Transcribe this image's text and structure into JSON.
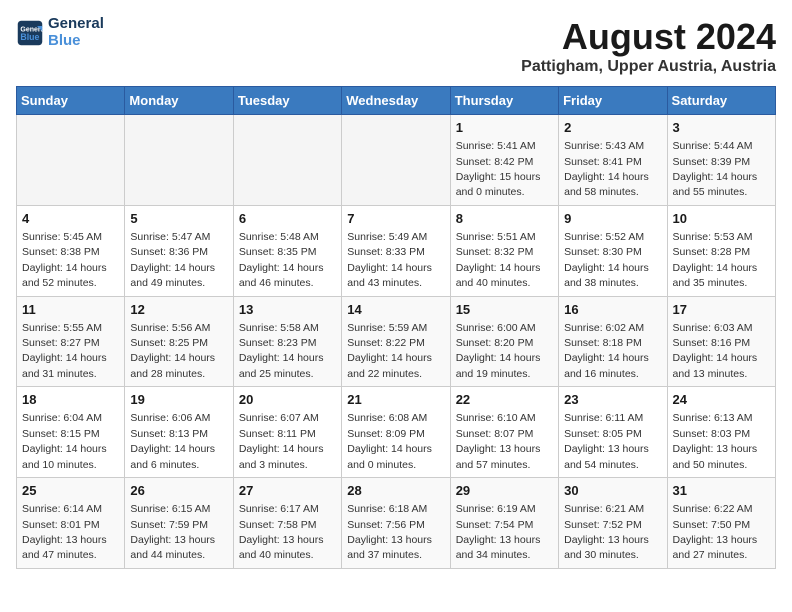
{
  "logo": {
    "line1": "General",
    "line2": "Blue"
  },
  "title": "August 2024",
  "subtitle": "Pattigham, Upper Austria, Austria",
  "days_of_week": [
    "Sunday",
    "Monday",
    "Tuesday",
    "Wednesday",
    "Thursday",
    "Friday",
    "Saturday"
  ],
  "weeks": [
    [
      {
        "day": "",
        "info": ""
      },
      {
        "day": "",
        "info": ""
      },
      {
        "day": "",
        "info": ""
      },
      {
        "day": "",
        "info": ""
      },
      {
        "day": "1",
        "info": "Sunrise: 5:41 AM\nSunset: 8:42 PM\nDaylight: 15 hours and 0 minutes."
      },
      {
        "day": "2",
        "info": "Sunrise: 5:43 AM\nSunset: 8:41 PM\nDaylight: 14 hours and 58 minutes."
      },
      {
        "day": "3",
        "info": "Sunrise: 5:44 AM\nSunset: 8:39 PM\nDaylight: 14 hours and 55 minutes."
      }
    ],
    [
      {
        "day": "4",
        "info": "Sunrise: 5:45 AM\nSunset: 8:38 PM\nDaylight: 14 hours and 52 minutes."
      },
      {
        "day": "5",
        "info": "Sunrise: 5:47 AM\nSunset: 8:36 PM\nDaylight: 14 hours and 49 minutes."
      },
      {
        "day": "6",
        "info": "Sunrise: 5:48 AM\nSunset: 8:35 PM\nDaylight: 14 hours and 46 minutes."
      },
      {
        "day": "7",
        "info": "Sunrise: 5:49 AM\nSunset: 8:33 PM\nDaylight: 14 hours and 43 minutes."
      },
      {
        "day": "8",
        "info": "Sunrise: 5:51 AM\nSunset: 8:32 PM\nDaylight: 14 hours and 40 minutes."
      },
      {
        "day": "9",
        "info": "Sunrise: 5:52 AM\nSunset: 8:30 PM\nDaylight: 14 hours and 38 minutes."
      },
      {
        "day": "10",
        "info": "Sunrise: 5:53 AM\nSunset: 8:28 PM\nDaylight: 14 hours and 35 minutes."
      }
    ],
    [
      {
        "day": "11",
        "info": "Sunrise: 5:55 AM\nSunset: 8:27 PM\nDaylight: 14 hours and 31 minutes."
      },
      {
        "day": "12",
        "info": "Sunrise: 5:56 AM\nSunset: 8:25 PM\nDaylight: 14 hours and 28 minutes."
      },
      {
        "day": "13",
        "info": "Sunrise: 5:58 AM\nSunset: 8:23 PM\nDaylight: 14 hours and 25 minutes."
      },
      {
        "day": "14",
        "info": "Sunrise: 5:59 AM\nSunset: 8:22 PM\nDaylight: 14 hours and 22 minutes."
      },
      {
        "day": "15",
        "info": "Sunrise: 6:00 AM\nSunset: 8:20 PM\nDaylight: 14 hours and 19 minutes."
      },
      {
        "day": "16",
        "info": "Sunrise: 6:02 AM\nSunset: 8:18 PM\nDaylight: 14 hours and 16 minutes."
      },
      {
        "day": "17",
        "info": "Sunrise: 6:03 AM\nSunset: 8:16 PM\nDaylight: 14 hours and 13 minutes."
      }
    ],
    [
      {
        "day": "18",
        "info": "Sunrise: 6:04 AM\nSunset: 8:15 PM\nDaylight: 14 hours and 10 minutes."
      },
      {
        "day": "19",
        "info": "Sunrise: 6:06 AM\nSunset: 8:13 PM\nDaylight: 14 hours and 6 minutes."
      },
      {
        "day": "20",
        "info": "Sunrise: 6:07 AM\nSunset: 8:11 PM\nDaylight: 14 hours and 3 minutes."
      },
      {
        "day": "21",
        "info": "Sunrise: 6:08 AM\nSunset: 8:09 PM\nDaylight: 14 hours and 0 minutes."
      },
      {
        "day": "22",
        "info": "Sunrise: 6:10 AM\nSunset: 8:07 PM\nDaylight: 13 hours and 57 minutes."
      },
      {
        "day": "23",
        "info": "Sunrise: 6:11 AM\nSunset: 8:05 PM\nDaylight: 13 hours and 54 minutes."
      },
      {
        "day": "24",
        "info": "Sunrise: 6:13 AM\nSunset: 8:03 PM\nDaylight: 13 hours and 50 minutes."
      }
    ],
    [
      {
        "day": "25",
        "info": "Sunrise: 6:14 AM\nSunset: 8:01 PM\nDaylight: 13 hours and 47 minutes."
      },
      {
        "day": "26",
        "info": "Sunrise: 6:15 AM\nSunset: 7:59 PM\nDaylight: 13 hours and 44 minutes."
      },
      {
        "day": "27",
        "info": "Sunrise: 6:17 AM\nSunset: 7:58 PM\nDaylight: 13 hours and 40 minutes."
      },
      {
        "day": "28",
        "info": "Sunrise: 6:18 AM\nSunset: 7:56 PM\nDaylight: 13 hours and 37 minutes."
      },
      {
        "day": "29",
        "info": "Sunrise: 6:19 AM\nSunset: 7:54 PM\nDaylight: 13 hours and 34 minutes."
      },
      {
        "day": "30",
        "info": "Sunrise: 6:21 AM\nSunset: 7:52 PM\nDaylight: 13 hours and 30 minutes."
      },
      {
        "day": "31",
        "info": "Sunrise: 6:22 AM\nSunset: 7:50 PM\nDaylight: 13 hours and 27 minutes."
      }
    ]
  ]
}
